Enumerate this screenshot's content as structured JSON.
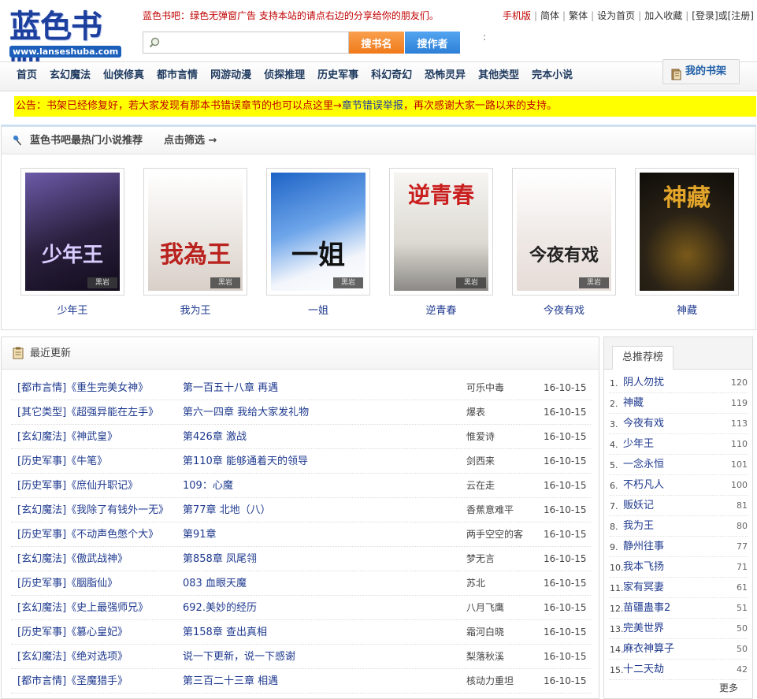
{
  "header": {
    "logo_text": "蓝色书吧",
    "logo_url": "www.lanseshuba.com",
    "slogan": "蓝色书吧：绿色无弹窗广告 支持本站的请点右边的分享给你的朋友们。",
    "toplinks": [
      "手机版",
      "简体",
      "繁体",
      "设为首页",
      "加入收藏",
      "[登录]或[注册]"
    ],
    "search_placeholder": "",
    "search_book_label": "搜书名",
    "search_author_label": "搜作者",
    "colon": ":"
  },
  "nav": {
    "items": [
      "首页",
      "玄幻魔法",
      "仙侠修真",
      "都市言情",
      "网游动漫",
      "侦探推理",
      "历史军事",
      "科幻奇幻",
      "恐怖灵异",
      "其他类型",
      "完本小说"
    ],
    "shelf_label": "我的书架"
  },
  "notice": {
    "prefix": "公告：",
    "text": "书架已经修复好，若大家发现有那本书错误章节的也可以点这里→",
    "link": "章节错误举报",
    "suffix": "，再次感谢大家一路以来的支持。"
  },
  "hot": {
    "title": "蓝色书吧最热门小说推荐",
    "filter": "点击筛选 →",
    "books": [
      {
        "name": "少年王",
        "bg": "#3a2d55",
        "accent": "#8f77c9",
        "cover_text": "少年王"
      },
      {
        "name": "我为王",
        "bg": "#eeeae6",
        "accent": "#b9221d",
        "cover_text": "我為王"
      },
      {
        "name": "一姐",
        "bg": "#1d63c6",
        "accent": "#f0f4ff",
        "cover_text": "一姐"
      },
      {
        "name": "逆青春",
        "bg": "#f3f2ef",
        "accent": "#c91f1f",
        "cover_text": "逆青春"
      },
      {
        "name": "今夜有戏",
        "bg": "#f4f0ee",
        "accent": "#2a2a2a",
        "cover_text": "今夜有戏"
      },
      {
        "name": "神藏",
        "bg": "#1b1812",
        "accent": "#e4a62a",
        "cover_text": "神藏"
      }
    ],
    "cover_tag": "黑岩"
  },
  "recent": {
    "title": "最近更新",
    "rows": [
      {
        "cat": "[都市言情]《重生完美女神》",
        "chapter": "第一百五十八章 再遇",
        "author": "可乐中毒",
        "date": "16-10-15"
      },
      {
        "cat": "[其它类型]《超强异能在左手》",
        "chapter": "第六一四章 我给大家发礼物",
        "author": "爆表",
        "date": "16-10-15"
      },
      {
        "cat": "[玄幻魔法]《神武皇》",
        "chapter": "第426章 激战",
        "author": "惟爱诗",
        "date": "16-10-15"
      },
      {
        "cat": "[历史军事]《牛笔》",
        "chapter": "第110章 能够通着天的领导",
        "author": "剑西来",
        "date": "16-10-15"
      },
      {
        "cat": "[历史军事]《庶仙升职记》",
        "chapter": "109：心魔",
        "author": "云在走",
        "date": "16-10-15"
      },
      {
        "cat": "[玄幻魔法]《我除了有钱外一无》",
        "chapter": "第77章 北地（八）",
        "author": "香蕉意难平",
        "date": "16-10-15"
      },
      {
        "cat": "[历史军事]《不动声色憋个大》",
        "chapter": "第91章",
        "author": "两手空空的客",
        "date": "16-10-15"
      },
      {
        "cat": "[玄幻魔法]《傲武战神》",
        "chapter": "第858章 凤尾翎",
        "author": "梦无言",
        "date": "16-10-15"
      },
      {
        "cat": "[历史军事]《胭脂仙》",
        "chapter": "083 血眼天魔",
        "author": "苏北",
        "date": "16-10-15"
      },
      {
        "cat": "[玄幻魔法]《史上最强师兄》",
        "chapter": "692.美妙的经历",
        "author": "八月飞鹰",
        "date": "16-10-15"
      },
      {
        "cat": "[历史军事]《篡心皇妃》",
        "chapter": "第158章 查出真相",
        "author": "霜河白晓",
        "date": "16-10-15"
      },
      {
        "cat": "[玄幻魔法]《绝对选项》",
        "chapter": "说一下更新，说一下感谢",
        "author": "梨落秋溪",
        "date": "16-10-15"
      },
      {
        "cat": "[都市言情]《圣魔猎手》",
        "chapter": "第三百二十三章 相遇",
        "author": "核动力重坦",
        "date": "16-10-15"
      }
    ]
  },
  "rank": {
    "tab": "总推荐榜",
    "items": [
      {
        "num": "1.",
        "name": "阴人勿扰",
        "count": "120"
      },
      {
        "num": "2.",
        "name": "神藏",
        "count": "119"
      },
      {
        "num": "3.",
        "name": "今夜有戏",
        "count": "113"
      },
      {
        "num": "4.",
        "name": "少年王",
        "count": "110"
      },
      {
        "num": "5.",
        "name": "一念永恒",
        "count": "101"
      },
      {
        "num": "6.",
        "name": "不朽凡人",
        "count": "100"
      },
      {
        "num": "7.",
        "name": "贩妖记",
        "count": "81"
      },
      {
        "num": "8.",
        "name": "我为王",
        "count": "80"
      },
      {
        "num": "9.",
        "name": "静州往事",
        "count": "77"
      },
      {
        "num": "10.",
        "name": "我本飞扬",
        "count": "71"
      },
      {
        "num": "11.",
        "name": "家有冥妻",
        "count": "61"
      },
      {
        "num": "12.",
        "name": "苗疆蛊事2",
        "count": "51"
      },
      {
        "num": "13.",
        "name": "完美世界",
        "count": "50"
      },
      {
        "num": "14.",
        "name": "麻衣神算子",
        "count": "50"
      },
      {
        "num": "15.",
        "name": "十二天劫",
        "count": "42"
      }
    ],
    "more": "更多"
  }
}
